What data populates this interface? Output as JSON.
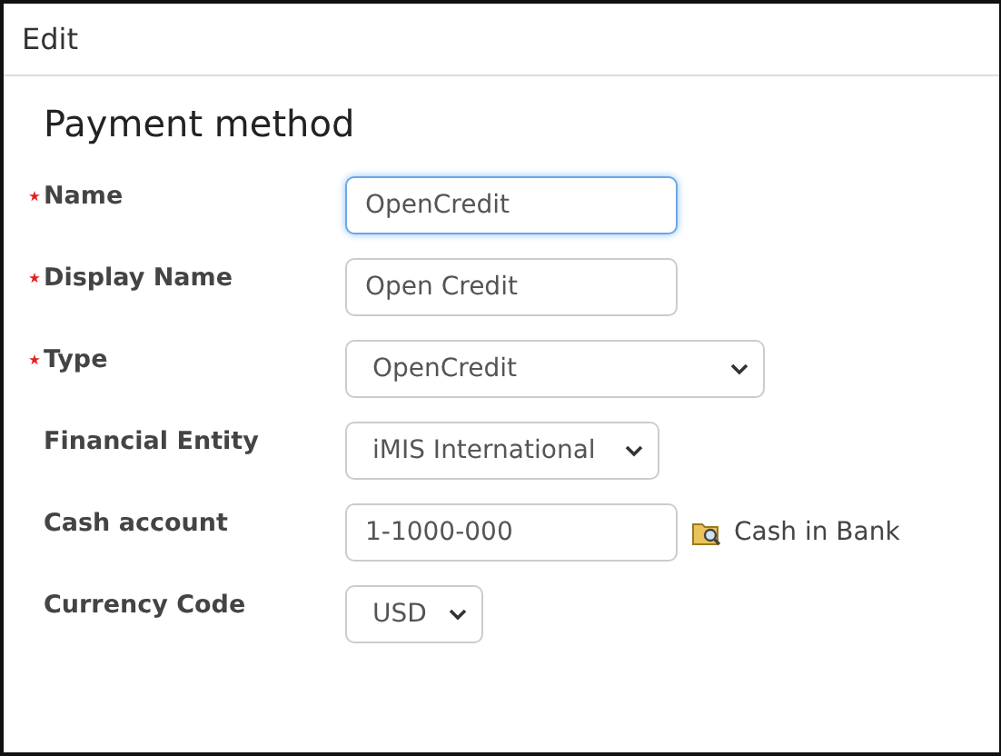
{
  "window": {
    "title": "Edit"
  },
  "heading": "Payment method",
  "fields": [
    {
      "label": "Name",
      "required": true,
      "kind": "input",
      "value": "OpenCredit",
      "focused": true
    },
    {
      "label": "Display Name",
      "required": true,
      "kind": "input",
      "value": "Open Credit",
      "focused": false
    },
    {
      "label": "Type",
      "required": true,
      "kind": "select",
      "value": "OpenCredit",
      "focused": false
    },
    {
      "label": "Financial Entity",
      "required": false,
      "kind": "select",
      "value": "iMIS International",
      "focused": false
    },
    {
      "label": "Cash account",
      "required": false,
      "kind": "input",
      "value": "1-1000-000",
      "focused": false,
      "lookup": "Cash in Bank"
    },
    {
      "label": "Currency Code",
      "required": false,
      "kind": "select",
      "value": "USD",
      "focused": false
    }
  ]
}
